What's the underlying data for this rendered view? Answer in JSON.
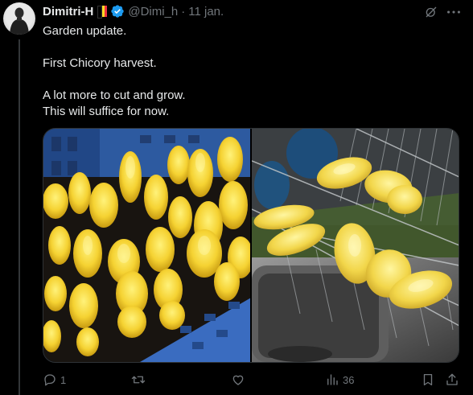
{
  "author": {
    "name": "Dimitri-H",
    "handle": "@Dimi_h",
    "separator": "·",
    "date": "11 jan."
  },
  "colors": {
    "flag": [
      "#000000",
      "#fdda24",
      "#ef3340"
    ],
    "verified": "#1d9bf0",
    "muted": "#71767b",
    "text": "#e7e9ea"
  },
  "icons": [
    "grok-icon",
    "more-icon",
    "reply-icon",
    "retweet-icon",
    "like-icon",
    "views-icon",
    "bookmark-icon",
    "share-icon"
  ],
  "tweet": {
    "lines": [
      "Garden update.",
      "First Chicory harvest.",
      "A lot more to cut and grow.",
      "This will suffice for now."
    ]
  },
  "media": {
    "photo_1": "chicory-in-crate",
    "photo_2": "chicory-on-dish-rack"
  },
  "actions": {
    "reply_count": "1",
    "retweet_count": "",
    "like_count": "",
    "views_count": "36"
  }
}
